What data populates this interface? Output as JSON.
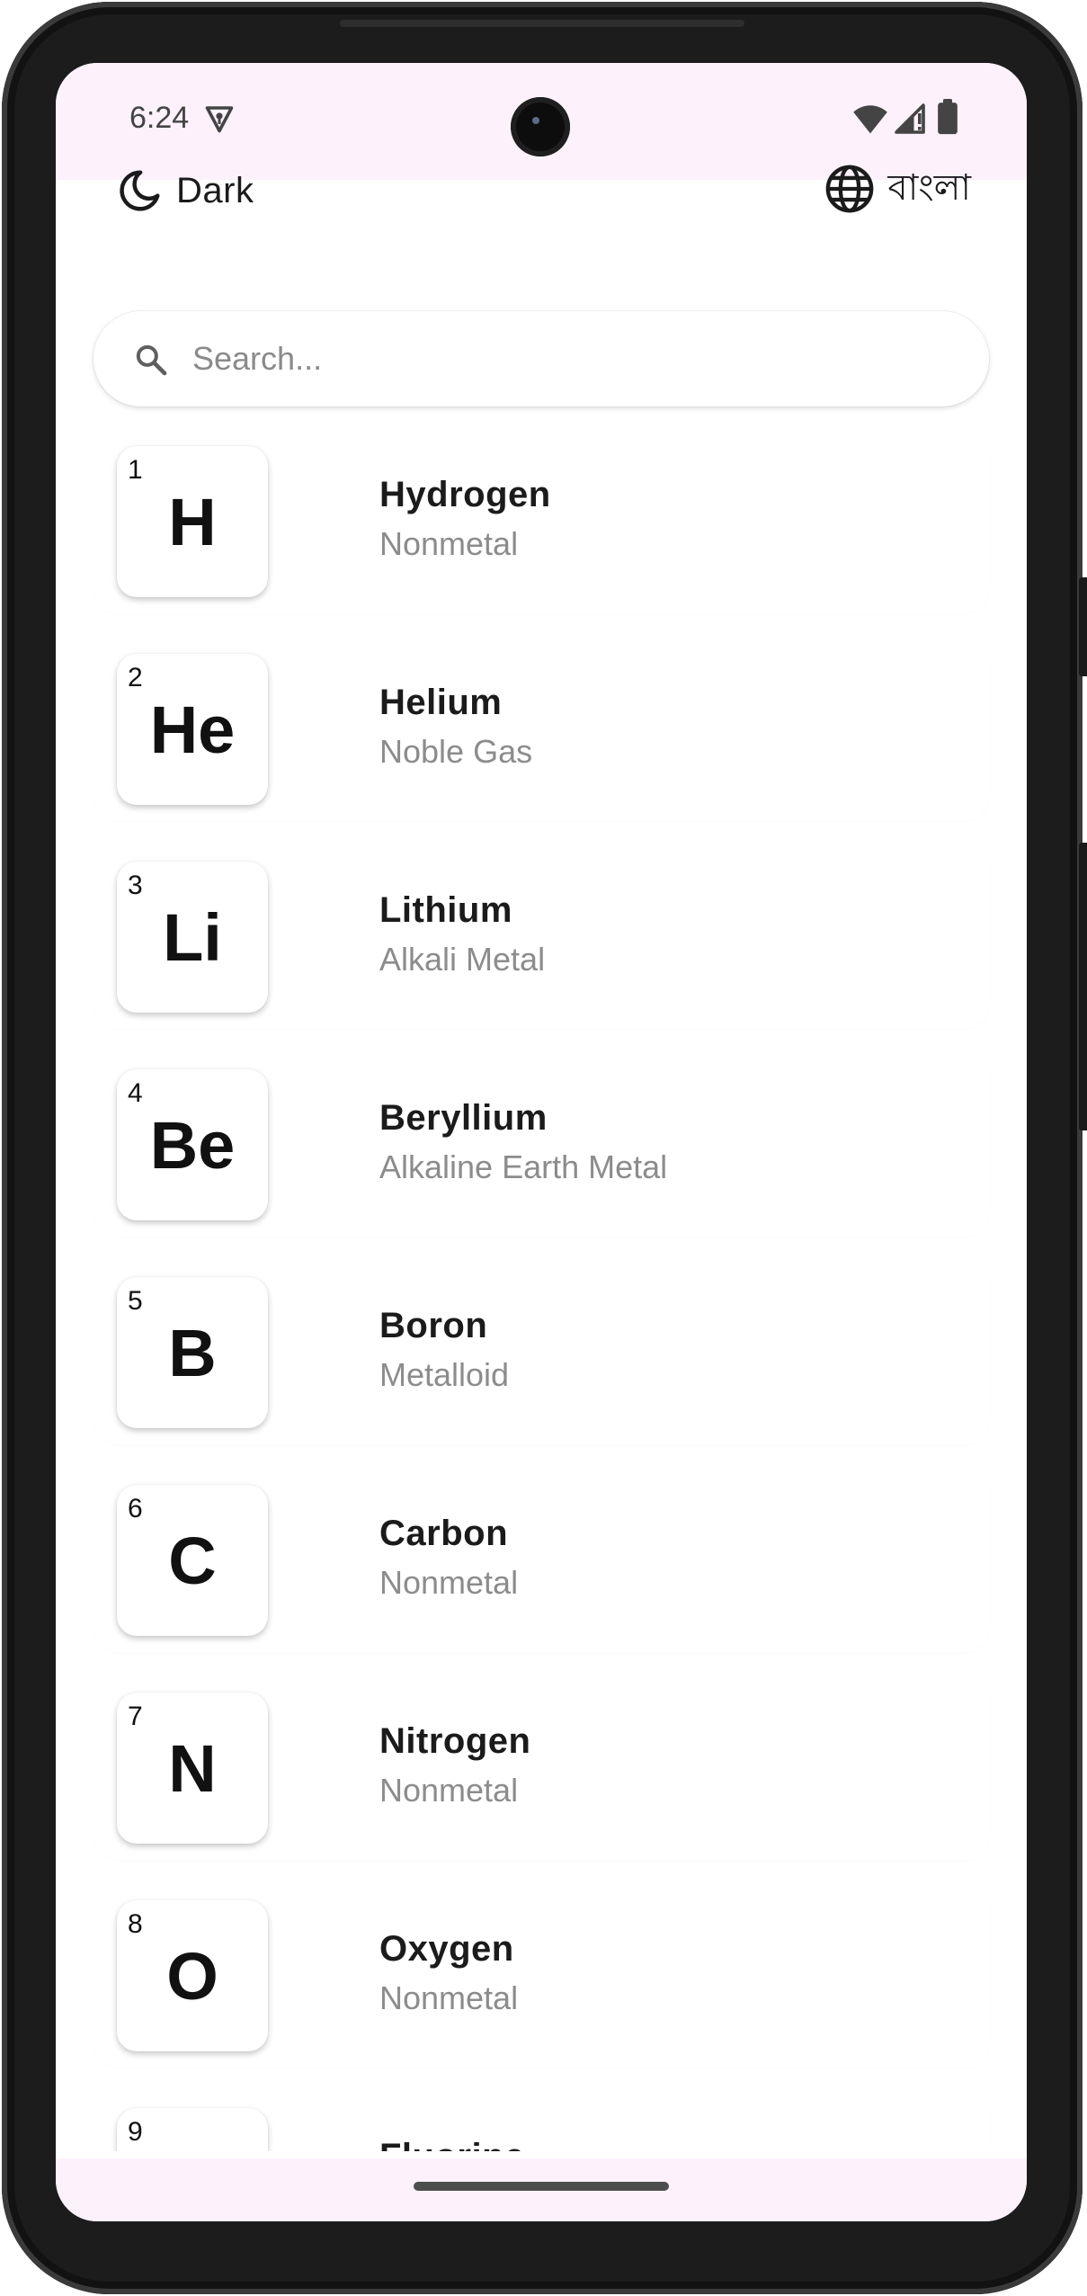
{
  "status_bar": {
    "time": "6:24",
    "vpn_icon": "vpn-key-icon",
    "wifi_icon": "wifi-icon",
    "signal_icon": "signal-icon",
    "battery_icon": "battery-icon"
  },
  "header": {
    "theme_label": "Dark",
    "theme_icon": "moon-icon",
    "language_label": "বাংলা",
    "language_icon": "globe-icon"
  },
  "search": {
    "placeholder": "Search...",
    "value": "",
    "icon": "search-icon"
  },
  "elements": [
    {
      "number": "1",
      "symbol": "H",
      "name": "Hydrogen",
      "category": "Nonmetal"
    },
    {
      "number": "2",
      "symbol": "He",
      "name": "Helium",
      "category": "Noble Gas"
    },
    {
      "number": "3",
      "symbol": "Li",
      "name": "Lithium",
      "category": "Alkali Metal"
    },
    {
      "number": "4",
      "symbol": "Be",
      "name": "Beryllium",
      "category": "Alkaline Earth Metal"
    },
    {
      "number": "5",
      "symbol": "B",
      "name": "Boron",
      "category": "Metalloid"
    },
    {
      "number": "6",
      "symbol": "C",
      "name": "Carbon",
      "category": "Nonmetal"
    },
    {
      "number": "7",
      "symbol": "N",
      "name": "Nitrogen",
      "category": "Nonmetal"
    },
    {
      "number": "8",
      "symbol": "O",
      "name": "Oxygen",
      "category": "Nonmetal"
    },
    {
      "number": "9",
      "symbol": "",
      "name": "Fluorine",
      "category": ""
    }
  ],
  "colors": {
    "system_bar_bg": "#fdf2fb",
    "text_primary": "#1b1b1b",
    "text_secondary": "#8c8c8c"
  }
}
